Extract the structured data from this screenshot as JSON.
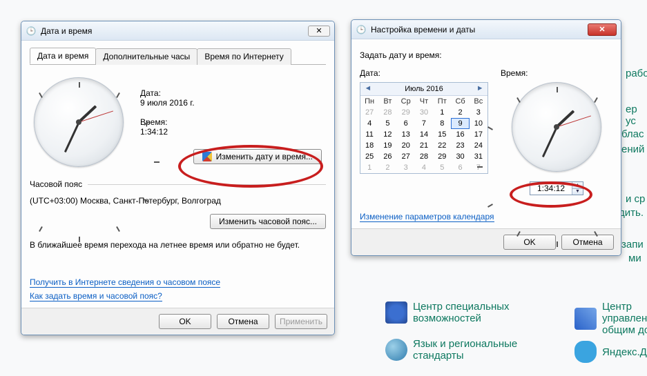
{
  "bg": {
    "special": "Центр специальных возможностей",
    "manage": "Центр управлени и общим дост",
    "lang": "Язык и региональные стандарты",
    "yadisk": "Яндекс.Диск",
    "frag": [
      "работ",
      "ер ус",
      "блас",
      "ений",
      "и ср",
      "дить.",
      "запи",
      "ми"
    ]
  },
  "win1": {
    "title": "Дата и время",
    "tabs": [
      "Дата и время",
      "Дополнительные часы",
      "Время по Интернету"
    ],
    "date_label": "Дата:",
    "date_value": "9 июля 2016 г.",
    "time_label": "Время:",
    "time_value": "1:34:12",
    "change_dt_btn": "Изменить дату и время...",
    "tz_heading": "Часовой пояс",
    "tz_value": "(UTC+03:00) Москва, Санкт-Петербург, Волгоград",
    "change_tz_btn": "Изменить часовой пояс...",
    "dst_note": "В ближайшее время перехода на летнее время или обратно не будет.",
    "link1": "Получить в Интернете сведения о часовом поясе",
    "link2": "Как задать время и часовой пояс?",
    "ok": "OK",
    "cancel": "Отмена",
    "apply": "Применить"
  },
  "win2": {
    "title": "Настройка времени и даты",
    "set_label": "Задать дату и время:",
    "date_label": "Дата:",
    "time_label": "Время:",
    "month": "Июль 2016",
    "dow": [
      "Пн",
      "Вт",
      "Ср",
      "Чт",
      "Пт",
      "Сб",
      "Вс"
    ],
    "time_value": "1:34:12",
    "cal_link": "Изменение параметров календаря",
    "ok": "OK",
    "cancel": "Отмена",
    "calendar": {
      "leading": [
        27,
        28,
        29,
        30
      ],
      "days": 31,
      "trailing": [
        1,
        2,
        3,
        4,
        5,
        6,
        7
      ],
      "selected": 9
    }
  }
}
